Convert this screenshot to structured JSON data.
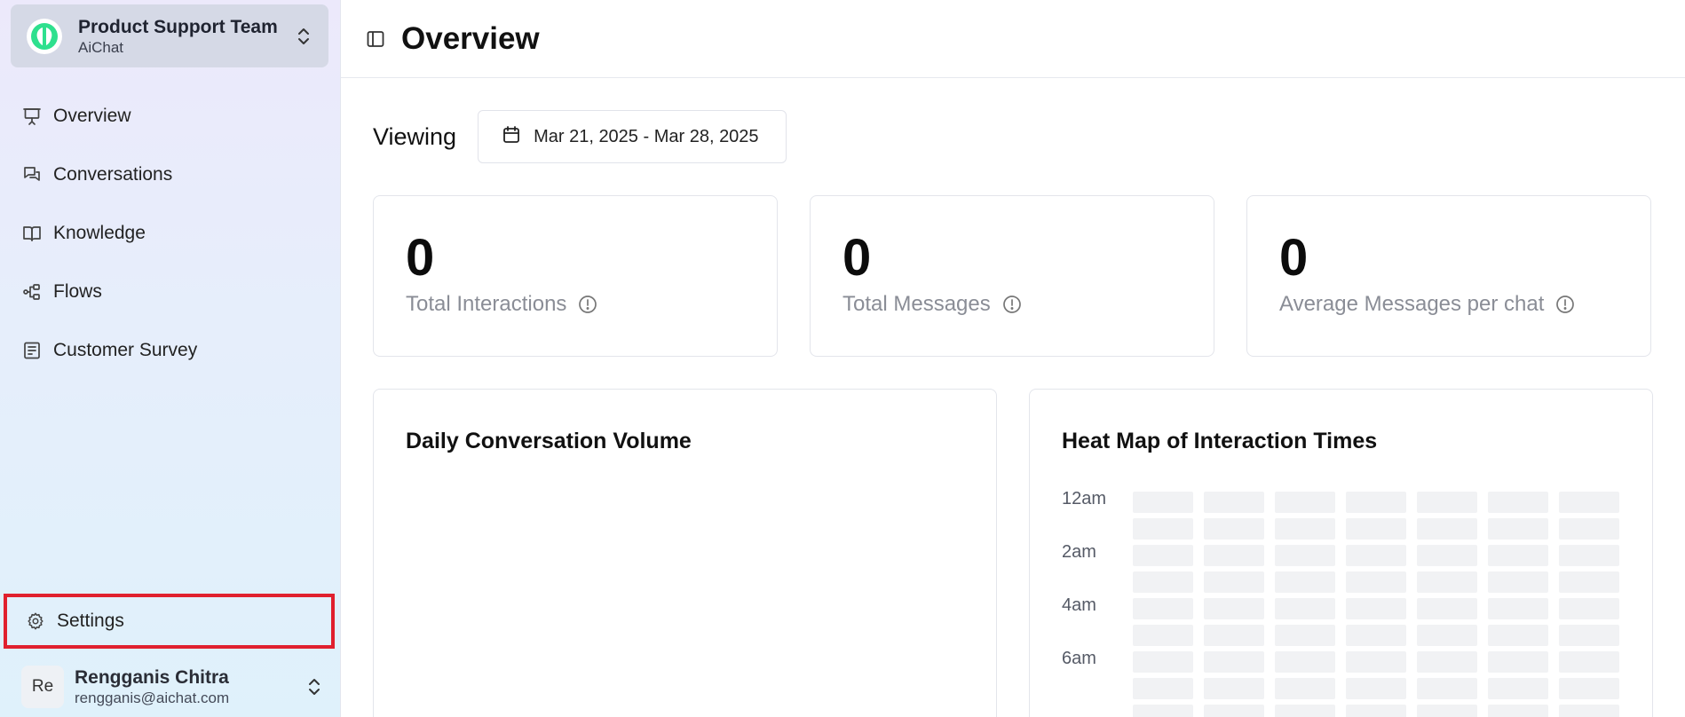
{
  "team": {
    "name": "Product Support Team",
    "subtitle": "AiChat",
    "accent": "#2ee08e"
  },
  "sidebar": {
    "items": [
      {
        "label": "Overview",
        "icon": "presentation-icon"
      },
      {
        "label": "Conversations",
        "icon": "chat-bubbles-icon"
      },
      {
        "label": "Knowledge",
        "icon": "book-open-icon"
      },
      {
        "label": "Flows",
        "icon": "flow-icon"
      },
      {
        "label": "Customer Survey",
        "icon": "survey-icon"
      }
    ],
    "settings_label": "Settings"
  },
  "user": {
    "initials": "Re",
    "name": "Rengganis Chitra",
    "email": "rengganis@aichat.com"
  },
  "header": {
    "title": "Overview"
  },
  "viewing": {
    "label": "Viewing",
    "date_range": "Mar 21, 2025 - Mar 28, 2025"
  },
  "stats": [
    {
      "value": "0",
      "label": "Total Interactions"
    },
    {
      "value": "0",
      "label": "Total Messages"
    },
    {
      "value": "0",
      "label": "Average Messages per chat"
    }
  ],
  "charts": {
    "daily_title": "Daily Conversation Volume",
    "heatmap_title": "Heat Map of Interaction Times",
    "heatmap_hour_labels": [
      "12am",
      "2am",
      "4am",
      "6am"
    ]
  },
  "colors": {
    "highlight": "#e0202e",
    "heat_empty": "#f1f2f4"
  }
}
